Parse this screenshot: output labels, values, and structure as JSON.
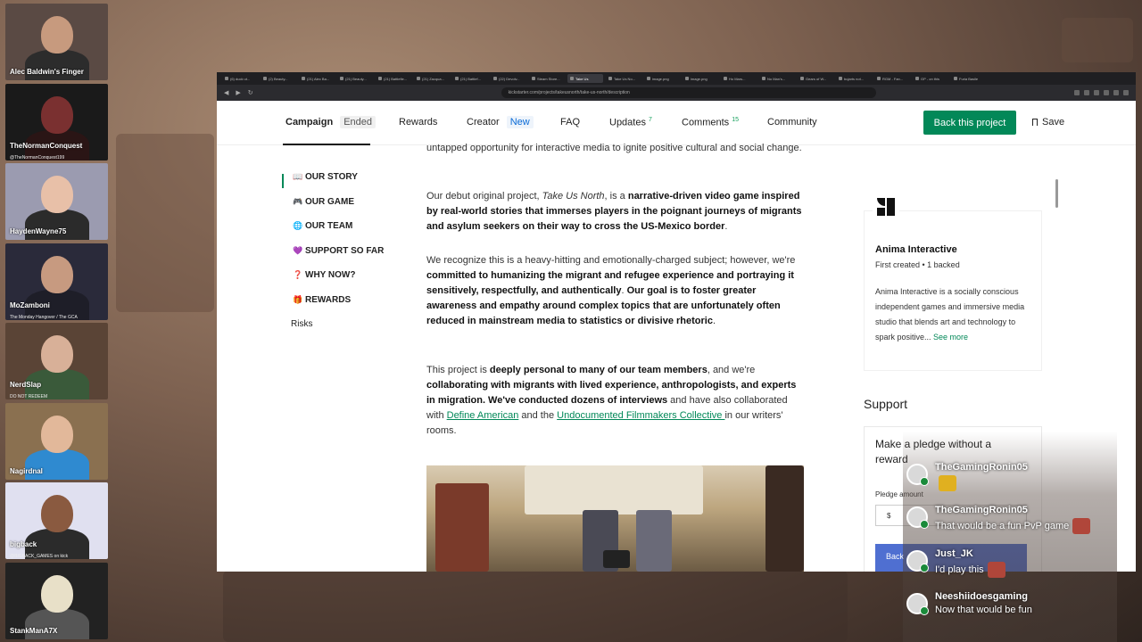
{
  "cams": [
    {
      "name": "Alec Baldwin's Finger",
      "sub": "",
      "face": "#c79a7e",
      "body": "#2c2c2c",
      "bg": "#5a4a44"
    },
    {
      "name": "TheNormanConquest",
      "sub": "@TheNormanConquest199",
      "face": "#7a3030",
      "body": "#2a1515",
      "bg": "#1a1a1a"
    },
    {
      "name": "HaydenWayne75",
      "sub": "",
      "face": "#e8c0a8",
      "body": "#2b2b2b",
      "bg": "#9b9bb0"
    },
    {
      "name": "MoZamboni",
      "sub": "The Monday Hangover / The GCA",
      "face": "#c79a80",
      "body": "#1e1e28",
      "bg": "#2a2a3a"
    },
    {
      "name": "NerdSlap",
      "sub": "DO NOT REDEEM",
      "face": "#d8b098",
      "body": "#3a5a3a",
      "bg": "#5a4436"
    },
    {
      "name": "Nagirdnal",
      "sub": "",
      "face": "#e2b89a",
      "body": "#2f8ad0",
      "bg": "#8a7050"
    },
    {
      "name": "bigback",
      "sub": "@BIGBACK_GAMES on kick",
      "face": "#8a5a40",
      "body": "#2b2b2b",
      "bg": "#e0e0f0"
    },
    {
      "name": "StankManA7X",
      "sub": "",
      "face": "#e8e0c8",
      "body": "#555",
      "bg": "#222"
    }
  ],
  "browser": {
    "tabs": [
      "(6) duck ut...",
      "(2) Beauty...",
      "(21) Alec Ba...",
      "(21) Beauty...",
      "(21) Battlefie...",
      "(21) Zacqua...",
      "(21) Battlef...",
      "(22) Devolv...",
      "Steam Store...",
      "Take Us",
      "Take Us No...",
      "image.png",
      "image.png",
      "Ho Mars...",
      "No Man's...",
      "Gears of W...",
      "bujarts not...",
      "RGM - Fan...",
      "GP - on this",
      "Furia Basile"
    ],
    "url": "kickstarter.com/projects/takeusnorth/take-us-north/description"
  },
  "nav": {
    "campaign": "Campaign",
    "campaign_status": "Ended",
    "rewards": "Rewards",
    "creator": "Creator",
    "creator_badge": "New",
    "faq": "FAQ",
    "updates": "Updates",
    "updates_count": "7",
    "comments": "Comments",
    "comments_count": "15",
    "community": "Community",
    "back_button": "Back this project",
    "save": "Save"
  },
  "toc": [
    {
      "icon": "📖",
      "label": "OUR STORY"
    },
    {
      "icon": "🎮",
      "label": "OUR GAME"
    },
    {
      "icon": "🌐",
      "label": "OUR TEAM"
    },
    {
      "icon": "💜",
      "label": "SUPPORT SO FAR"
    },
    {
      "icon": "❓",
      "label": "WHY NOW?"
    },
    {
      "icon": "🎁",
      "label": "REWARDS"
    },
    {
      "icon": "",
      "label": "Risks"
    }
  ],
  "story": {
    "p0": "untapped opportunity for interactive media to ignite positive cultural and social change.",
    "p1_a": "Our debut original project, ",
    "p1_title": "Take Us North",
    "p1_b": ", is a ",
    "p1_bold": "narrative-driven video game inspired by real-world stories that immerses players in the poignant journeys of migrants and asylum seekers on their way to cross the US-Mexico border",
    "p1_c": ".",
    "p2_a": "We recognize this is a heavy-hitting and emotionally-charged subject; however, we're ",
    "p2_bold": "committed to humanizing the migrant and refugee experience and portraying it sensitively, respectfully, and authentically",
    "p2_b": ". ",
    "p2_bold2": "Our goal is to foster greater awareness and empathy around complex topics that are unfortunately often reduced in mainstream media to statistics or divisive rhetoric",
    "p2_c": ".",
    "p3_a": "This project is ",
    "p3_bold": "deeply personal to many of our team members",
    "p3_b": ", and we're ",
    "p3_bold2": "collaborating with migrants with lived experience, anthropologists, and experts in migration. We've conducted dozens of interviews",
    "p3_c": " and have also collaborated with ",
    "p3_link1": "Define American",
    "p3_d": " and the ",
    "p3_link2": "Undocumented Filmmakers Collective ",
    "p3_e": "in our writers' rooms."
  },
  "creator": {
    "name": "Anima Interactive",
    "meta": "First created • 1 backed",
    "desc": "Anima Interactive is a socially conscious independent games and immersive media studio that blends art and technology to spark positive... ",
    "see_more": "See more"
  },
  "support": {
    "title": "Support",
    "pledge_title": "Make a pledge without a reward",
    "pledge_label": "Pledge amount",
    "currency": "$",
    "button": "Back"
  },
  "chat": [
    {
      "user": "TheGamingRonin05",
      "text": ""
    },
    {
      "user": "TheGamingRonin05",
      "text": "That would be a fun PvP game"
    },
    {
      "user": "Just_JK",
      "text": "I'd play this"
    },
    {
      "user": "Neeshiidoesgaming",
      "text": "Now that would be fun"
    }
  ],
  "colors": {
    "accent": "#028858",
    "link_blue": "#0a6bd6"
  }
}
